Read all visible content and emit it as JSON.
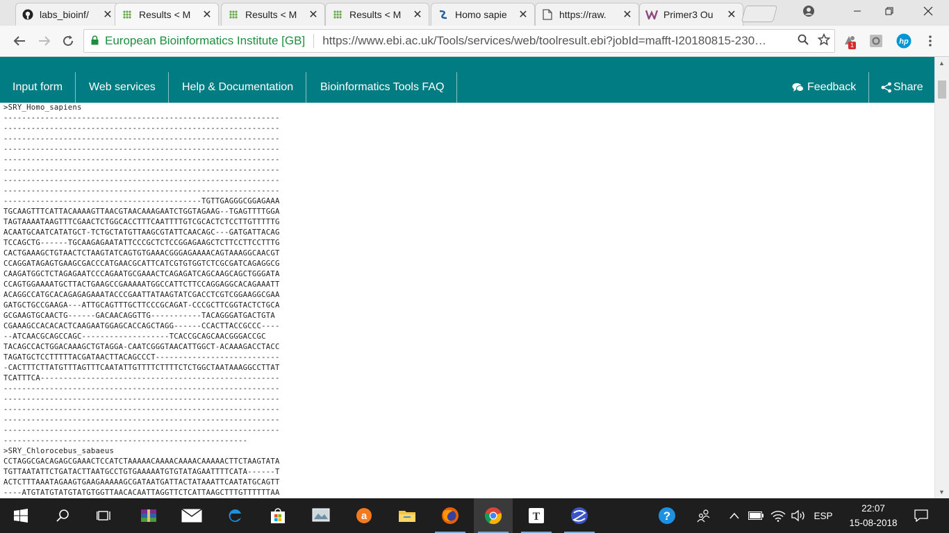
{
  "browser": {
    "tabs": [
      {
        "title": "labs_bioinf/",
        "icon": "github-icon",
        "active": false
      },
      {
        "title": "Results < M",
        "icon": "ebi-icon",
        "active": true
      },
      {
        "title": "Results < M",
        "icon": "ebi-icon",
        "active": false
      },
      {
        "title": "Results < M",
        "icon": "ebi-icon",
        "active": false
      },
      {
        "title": "Homo sapie",
        "icon": "ensembl-icon",
        "active": false
      },
      {
        "title": "https://raw.",
        "icon": "document-icon",
        "active": false
      },
      {
        "title": "Primer3 Ou",
        "icon": "primer3-icon",
        "active": false
      }
    ],
    "tab_close": "✕",
    "address": {
      "secure_label": "European Bioinformatics Institute [GB]",
      "url": "https://www.ebi.ac.uk/Tools/services/web/toolresult.ebi?jobId=mafft-I20180815-230…"
    },
    "extension_badge": "1"
  },
  "ebi_nav": {
    "links": [
      "Input form",
      "Web services",
      "Help & Documentation",
      "Bioinformatics Tools FAQ"
    ],
    "feedback": "Feedback",
    "share": "Share"
  },
  "alignment": {
    "lines": [
      ">SRY_Homo_sapiens",
      "------------------------------------------------------------",
      "------------------------------------------------------------",
      "------------------------------------------------------------",
      "------------------------------------------------------------",
      "------------------------------------------------------------",
      "------------------------------------------------------------",
      "------------------------------------------------------------",
      "------------------------------------------------------------",
      "-------------------------------------------TGTTGAGGGCGGAGAAA",
      "TGCAAGTTTCATTACAAAAGTTAACGTAACAAAGAATCTGGTAGAAG--TGAGTTTTGGA",
      "TAGTAAAATAAGTTTCGAACTCTGGCACCTTTCAATTTTGTCGCACTCTCCTTGTTTTTG",
      "ACAATGCAATCATATGCT-TCTGCTATGTTAAGCGTATTCAACAGC---GATGATTACAG",
      "TCCAGCTG------TGCAAGAGAATATTCCCGCTCTCCGGAGAAGCTCTTCCTTCCTTTG",
      "CACTGAAAGCTGTAACTCTAAGTATCAGTGTGAAACGGGAGAAAACAGTAAAGGCAACGT",
      "CCAGGATAGAGTGAAGCGACCCATGAACGCATTCATCGTGTGGTCTCGCGATCAGAGGCG",
      "CAAGATGGCTCTAGAGAATCCCAGAATGCGAAACTCAGAGATCAGCAAGCAGCTGGGATA",
      "CCAGTGGAAAATGCTTACTGAAGCCGAAAAATGGCCATTCTTCCAGGAGGCACAGAAATT",
      "ACAGGCCATGCACAGAGAGAAATACCCGAATTATAAGTATCGACCTCGTCGGAAGGCGAA",
      "GATGCTGCCGAAGA---ATTGCAGTTTGCTTCCCGCAGAT-CCCGCTTCGGTACTCTGCA",
      "GCGAAGTGCAACTG------GACAACAGGTTG-----------TACAGGGATGACTGTA",
      "CGAAAGCCACACACTCAAGAATGGAGCACCAGCTAGG------CCACTTACCGCCC----",
      "--ATCAACGCAGCCAGC-------------------TCACCGCAGCAACGGGACCGC",
      "TACAGCCACTGGACAAAGCTGTAGGA-CAATCGGGTAACATTGGCT-ACAAAGACCTACC",
      "TAGATGCTCCTTTTTACGATAACTTACAGCCCT---------------------------",
      "-CACTTTCTTATGTTTAGTTTCAATATTGTTTTCTTTTCTCTGGCTAATAAAGGCCTTAT",
      "TCATTTCA----------------------------------------------------",
      "------------------------------------------------------------",
      "------------------------------------------------------------",
      "------------------------------------------------------------",
      "------------------------------------------------------------",
      "------------------------------------------------------------",
      "-----------------------------------------------------",
      ">SRY_Chlorocebus_sabaeus",
      "CCTAGGCGACAGAGCGAAACTCCATCTAAAAACAAAACAAAACAAAAACTTCTAAGTATA",
      "TGTTAATATTCTGATACTTAATGCCTGTGAAAAATGTGTATAGAATTTTCATA------T",
      "ACTCTTTAAATAGAAGTGAAGAAAAAGCGATAATGATTACTATAAATTCAATATGCAGTT",
      "----ATGTATGTATGTATGTGGTTAACACAATTAGGTTCTCATTAAGCTTTGTTTTTTAA"
    ]
  },
  "taskbar": {
    "language": "ESP",
    "time": "22:07",
    "date": "15-08-2018"
  },
  "colors": {
    "ebi_teal": "#007c82",
    "secure_green": "#1e8e3e",
    "taskbar_bg": "#1e1e1e"
  }
}
